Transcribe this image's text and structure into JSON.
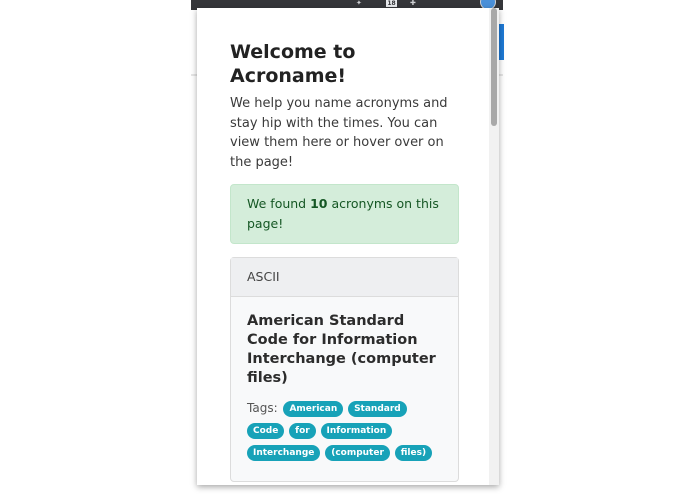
{
  "popup": {
    "title": "Welcome to Acroname!",
    "intro": "We help you name acronyms and stay hip with the times. You can view them here or hover over on the page!",
    "alert": {
      "prefix": "We found ",
      "count": "10",
      "suffix": " acronyms on this page!"
    },
    "card": {
      "acronym": "ASCII",
      "definition": "American Standard Code for Information Interchange (computer files)",
      "tags_label": "Tags:",
      "tags": [
        "American",
        "Standard",
        "Code",
        "for",
        "Information",
        "Interchange",
        "(computer",
        "files)"
      ]
    }
  },
  "browser": {
    "tab_count": "18"
  },
  "colors": {
    "alert_bg": "#d4edda",
    "alert_text": "#155724",
    "tag_bg": "#17a2b8"
  }
}
